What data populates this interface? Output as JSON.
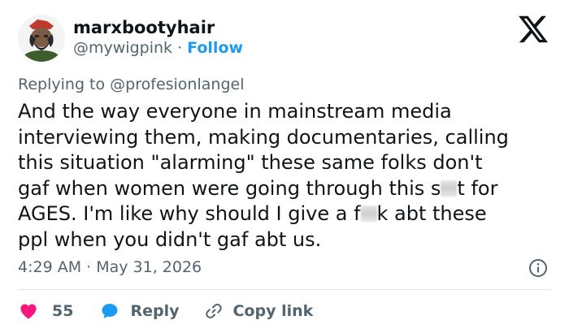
{
  "user": {
    "display_name": "marxbootyhair",
    "handle": "@mywigpink",
    "separator": "·",
    "follow_label": "Follow"
  },
  "reply": {
    "prefix": "Replying to",
    "to": "@profesionlangel"
  },
  "tweet": {
    "line1": "And the way everyone in mainstream media",
    "line2": "interviewing them, making documentaries, calling",
    "line3": "this situation \"alarming\" these same folks don't",
    "line4_before": "gaf when women were going through this s",
    "line4_after": "t for",
    "line5_before": "AGES. I'm like why should I give a f",
    "line5_after": "k abt these",
    "line6": "ppl when you didn't gaf abt us."
  },
  "meta": {
    "timestamp": "4:29 AM · May 31, 2026"
  },
  "actions": {
    "likes": "55",
    "reply_label": "Reply",
    "copy_link_label": "Copy link"
  },
  "colors": {
    "accent": "#1d9bf0",
    "like": "#f91880",
    "secondary_text": "#536471"
  },
  "icons": {
    "logo": "x-logo-icon",
    "info": "info-icon",
    "like": "heart-icon",
    "reply": "speech-bubble-icon",
    "copy_link": "link-icon"
  }
}
